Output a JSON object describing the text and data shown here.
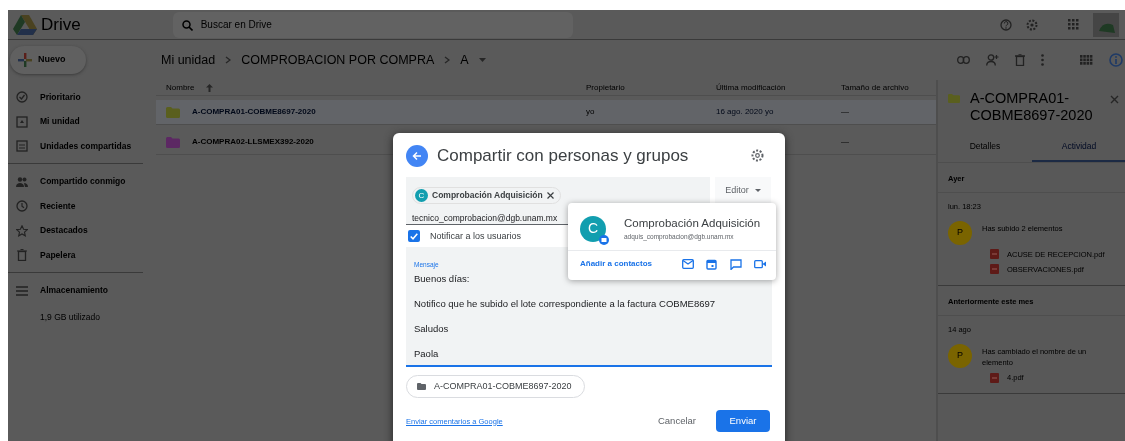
{
  "app": {
    "name": "Drive"
  },
  "search": {
    "placeholder": "Buscar en Drive"
  },
  "new_button": "Nuevo",
  "sidebar": {
    "groups": [
      [
        "Prioritario",
        "Mi unidad",
        "Unidades compartidas"
      ],
      [
        "Compartido conmigo",
        "Reciente",
        "Destacados",
        "Papelera"
      ]
    ],
    "storage": {
      "label": "Almacenamiento",
      "usage": "1,9 GB utilizado"
    }
  },
  "breadcrumb": [
    "Mi unidad",
    "COMPROBACION POR COMPRA",
    "A"
  ],
  "table": {
    "columns": [
      "Nombre",
      "Propietario",
      "Última modificación",
      "Tamaño de archivo"
    ],
    "rows": [
      {
        "name": "A-COMPRA01-COBME8697-2020",
        "owner": "yo",
        "modified": "16 ago. 2020 yo",
        "size": "—",
        "color": "#5a5f1e",
        "selected": true
      },
      {
        "name": "A-COMPRA02-LLSMEX392-2020",
        "size": "—",
        "color": "#5c2863",
        "selected": false
      }
    ]
  },
  "details_panel": {
    "title": "A-COMPRA01-COBME8697-2020",
    "tabs": [
      {
        "label": "Detalles",
        "selected": false
      },
      {
        "label": "Actividad",
        "selected": true
      }
    ],
    "sections": [
      {
        "heading": "Ayer",
        "events": [
          {
            "time": "lun. 18:23",
            "avatar": "P",
            "text": "Has subido 2 elementos",
            "files": [
              "ACUSE DE RECEPCION.pdf",
              "OBSERVACIONES.pdf"
            ]
          }
        ]
      },
      {
        "heading": "Anteriormente este mes",
        "events": [
          {
            "time": "14 ago",
            "avatar": "P",
            "text": "Has cambiado el nombre de un elemento",
            "files": [
              "4.pdf"
            ]
          }
        ]
      }
    ]
  },
  "share_dialog": {
    "title": "Compartir con personas y grupos",
    "chip": {
      "avatar": "C",
      "label": "Comprobación Adquisición"
    },
    "input_value": "tecnico_comprobacion@dgb.unam.mx",
    "role": "Editor",
    "notify": {
      "label": "Notificar a los usuarios",
      "checked": true
    },
    "message": {
      "label": "Mensaje",
      "paragraphs": [
        "Buenos días:",
        "Notifico que he subido el lote correspondiente a la factura COBME8697",
        "Saludos",
        "Paola"
      ]
    },
    "attachment": "A-COMPRA01-COBME8697-2020",
    "feedback_link": "Enviar comentarios a Google",
    "buttons": [
      {
        "label": "Cancelar",
        "kind": "text"
      },
      {
        "label": "Enviar",
        "kind": "primary"
      }
    ]
  },
  "contact_card": {
    "avatar": "C",
    "name": "Comprobación Adquisición",
    "email": "adquis_comprobacion@dgb.unam.mx",
    "add_link": "Añadir a contactos"
  }
}
